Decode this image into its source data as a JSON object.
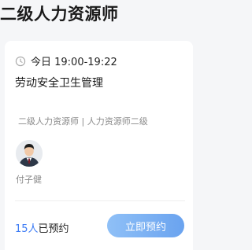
{
  "page": {
    "title": "二级人力资源师"
  },
  "card": {
    "time_text": "今日 19:00-19:22",
    "course_title": "劳动安全卫生管理",
    "tags_text": "二级人力资源师 | 人力资源师二级",
    "teacher_name": "付子健",
    "booked_count": "15人",
    "booked_suffix": "已预约",
    "reserve_label": "立即预约",
    "icons": {
      "time": "clock-icon",
      "teacher": "avatar"
    },
    "colors": {
      "accent": "#3d7cf5",
      "button_start": "#8fc0f7",
      "button_end": "#6aa3ef"
    }
  }
}
